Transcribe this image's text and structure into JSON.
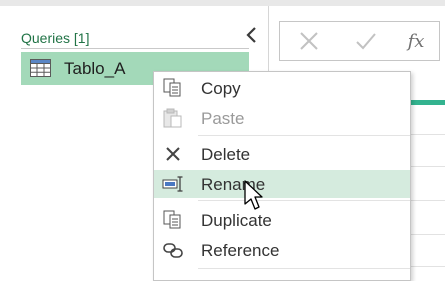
{
  "queries_pane": {
    "header": "Queries [1]",
    "items": [
      {
        "label": "Tablo_A",
        "icon": "table-icon"
      }
    ],
    "collapse_icon": "chevron-left-icon"
  },
  "formula_bar": {
    "cancel_icon": "x-icon",
    "commit_icon": "checkmark-icon",
    "fx_label": "fx"
  },
  "context_menu": {
    "items": [
      {
        "label": "Copy",
        "icon": "copy-icon",
        "enabled": true
      },
      {
        "label": "Paste",
        "icon": "paste-icon",
        "enabled": false
      },
      {
        "label": "Delete",
        "icon": "delete-icon",
        "enabled": true
      },
      {
        "label": "Rename",
        "icon": "rename-icon",
        "enabled": true,
        "hovered": true
      },
      {
        "label": "Duplicate",
        "icon": "duplicate-icon",
        "enabled": true
      },
      {
        "label": "Reference",
        "icon": "reference-icon",
        "enabled": true
      }
    ]
  },
  "colors": {
    "accent_green": "#217346",
    "selected_bg": "#a3d9b9",
    "hover_bg": "#d5ebde",
    "grid_accent": "#33b38f"
  }
}
